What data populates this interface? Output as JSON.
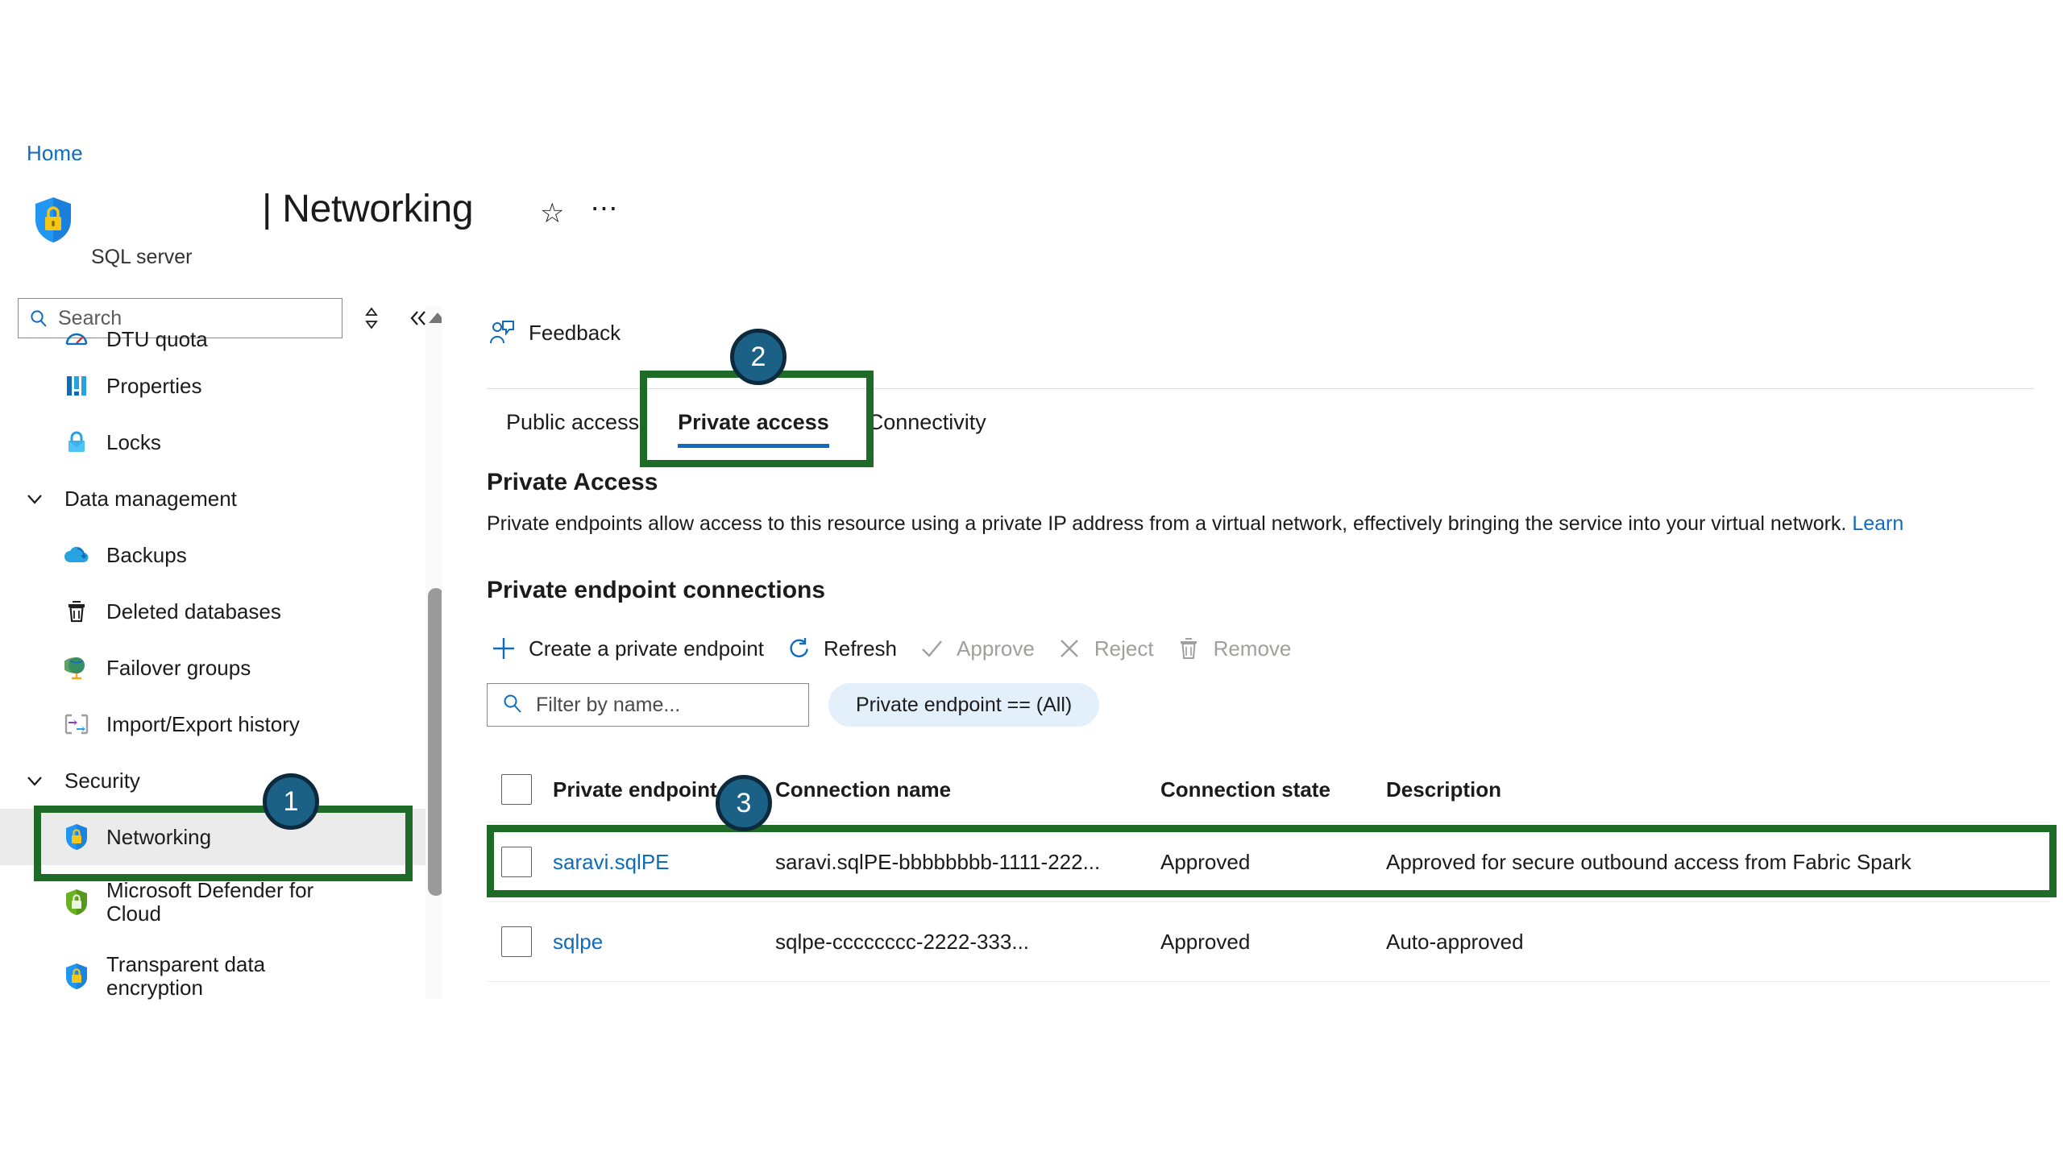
{
  "breadcrumb": {
    "home": "Home"
  },
  "header": {
    "resource_type": "SQL server",
    "title": "| Networking",
    "favorite_icon": "star-icon",
    "more_icon": "ellipsis-icon"
  },
  "sidebar": {
    "search_placeholder": "Search",
    "sort_icon": "sort-icon",
    "collapse_icon": "double-chevron-left-icon",
    "items": [
      {
        "label": "DTU quota",
        "icon": "gauge-icon",
        "type": "item",
        "selected": false,
        "clipped": true
      },
      {
        "label": "Properties",
        "icon": "properties-icon",
        "type": "item",
        "selected": false
      },
      {
        "label": "Locks",
        "icon": "lock-icon",
        "type": "item",
        "selected": false
      },
      {
        "label": "Data management",
        "icon": "chevron-down-icon",
        "type": "group"
      },
      {
        "label": "Backups",
        "icon": "cloud-backup-icon",
        "type": "item",
        "selected": false
      },
      {
        "label": "Deleted databases",
        "icon": "trash-icon",
        "type": "item",
        "selected": false
      },
      {
        "label": "Failover groups",
        "icon": "globe-icon",
        "type": "item",
        "selected": false
      },
      {
        "label": "Import/Export history",
        "icon": "import-export-icon",
        "type": "item",
        "selected": false
      },
      {
        "label": "Security",
        "icon": "chevron-down-icon",
        "type": "group"
      },
      {
        "label": "Networking",
        "icon": "shield-lock-blue-icon",
        "type": "item",
        "selected": true
      },
      {
        "label": "Microsoft Defender for Cloud",
        "icon": "shield-lock-green-icon",
        "type": "item",
        "selected": false
      },
      {
        "label": "Transparent data encryption",
        "icon": "shield-lock-blue-icon",
        "type": "item",
        "selected": false,
        "clipped": true
      }
    ]
  },
  "main": {
    "feedback_label": "Feedback",
    "feedback_icon": "feedback-person-icon",
    "tabs": [
      {
        "label": "Public access",
        "active": false
      },
      {
        "label": "Private access",
        "active": true
      },
      {
        "label": "Connectivity",
        "active": false
      }
    ],
    "section_title": "Private Access",
    "section_description": "Private endpoints allow access to this resource using a private IP address from a virtual network, effectively bringing the service into your virtual network.",
    "section_description_link": "Learn",
    "subsection_title": "Private endpoint connections",
    "commands": [
      {
        "label": "Create a private endpoint",
        "icon": "plus-icon",
        "disabled": false
      },
      {
        "label": "Refresh",
        "icon": "refresh-icon",
        "disabled": false
      },
      {
        "label": "Approve",
        "icon": "check-icon",
        "disabled": true
      },
      {
        "label": "Reject",
        "icon": "x-icon",
        "disabled": true
      },
      {
        "label": "Remove",
        "icon": "trash-icon",
        "disabled": true
      }
    ],
    "filter_placeholder": "Filter by name...",
    "filter_search_icon": "search-icon",
    "filter_pill": "Private endpoint == (All)",
    "table": {
      "columns": [
        "Private endpoint",
        "Connection name",
        "Connection state",
        "Description"
      ],
      "rows": [
        {
          "private_endpoint": "saravi.sqlPE",
          "connection_name": "saravi.sqlPE-bbbbbbbb-1111-222...",
          "connection_state": "Approved",
          "description": "Approved for secure outbound access from Fabric Spark",
          "checked": false
        },
        {
          "private_endpoint": "sqlpe",
          "connection_name": "sqlpe-cccccccc-2222-333...",
          "connection_state": "Approved",
          "description": "Auto-approved",
          "checked": false
        }
      ]
    }
  },
  "annotations": {
    "callout_color": "#1e6b28",
    "badge_fill": "#1b6186",
    "badge_border": "#0d2a3d",
    "badges": [
      {
        "number": "1",
        "target": "sidebar-item-networking"
      },
      {
        "number": "2",
        "target": "tab-private-access"
      },
      {
        "number": "3",
        "target": "table-row-saravi-sqlpe"
      }
    ]
  }
}
